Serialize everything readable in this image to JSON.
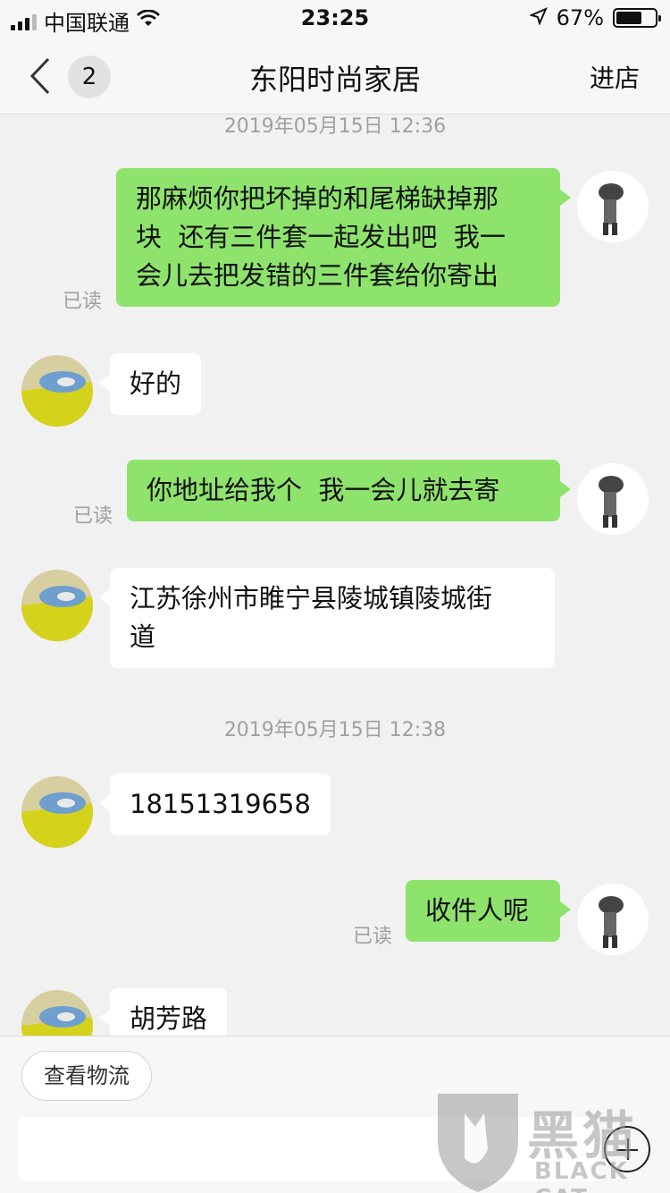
{
  "status_bar": {
    "carrier": "中国联通",
    "time": "23:25",
    "battery": "67%",
    "battery_level": 0.67
  },
  "nav": {
    "back_label": "<",
    "unread_count": "2",
    "title": "东阳时尚家居",
    "enter_store": "进店"
  },
  "chat": {
    "timestamps": [
      "2019年05月15日 12:36",
      "2019年05月15日 12:38"
    ],
    "read_label": "已读",
    "messages": [
      {
        "side": "out",
        "lines": [
          "那麻烦你把坏掉的和尾梯缺掉那",
          "块  还有三件套一起发出吧  我一",
          "会儿去把发错的三件套给你寄出"
        ]
      },
      {
        "side": "in",
        "text": "好的"
      },
      {
        "side": "out",
        "text": "你地址给我个  我一会儿就去寄"
      },
      {
        "side": "in",
        "lines": [
          "江苏徐州市睢宁县陵城镇陵城街",
          "道"
        ]
      },
      {
        "side": "in",
        "text": "18151319658"
      },
      {
        "side": "out",
        "text": "收件人呢"
      },
      {
        "side": "in",
        "text": "胡芳路"
      }
    ]
  },
  "bottom": {
    "logistics_button": "查看物流",
    "input_placeholder": ""
  },
  "watermark": {
    "text": "黑猫",
    "sub": "BLACK CAT"
  }
}
